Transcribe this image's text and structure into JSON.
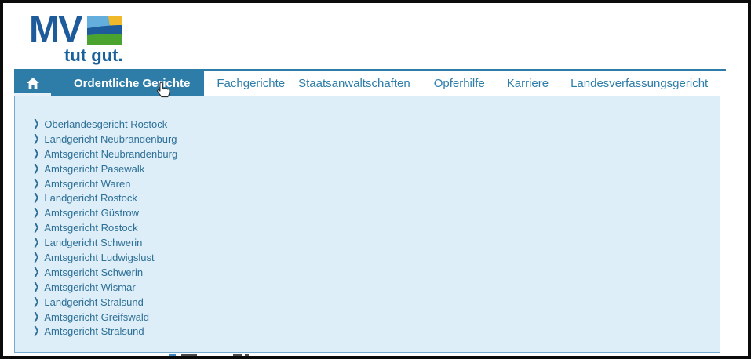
{
  "logo": {
    "text": "MV",
    "tagline": "tut gut."
  },
  "nav": {
    "active_index": 0,
    "items": [
      "Ordentliche Gerichte",
      "Fachgerichte",
      "Staatsanwaltschaften",
      "Opferhilfe",
      "Karriere",
      "Landesverfassungsgericht"
    ]
  },
  "dropdown": {
    "chevron": "❯",
    "items": [
      "Oberlandesgericht Rostock",
      "Landgericht Neubrandenburg",
      "Amtsgericht Neubrandenburg",
      "Amtsgericht Pasewalk",
      "Amtsgericht Waren",
      "Landgericht Rostock",
      "Amtsgericht Güstrow",
      "Amtsgericht Rostock",
      "Landgericht Schwerin",
      "Amtsgericht Ludwigslust",
      "Amtsgericht Schwerin",
      "Amtsgericht Wismar",
      "Landgericht Stralsund",
      "Amtsgericht Greifswald",
      "Amtsgericht Stralsund"
    ]
  },
  "colors": {
    "brand_blue": "#1d5b9b",
    "tagline_blue": "#18619d",
    "nav_blue": "#2d7da8",
    "panel_bg": "#ddeef8",
    "panel_border": "#74abcf",
    "list_text": "#2d6f96",
    "flag_sky": "#63aedd",
    "flag_yellow": "#f0b929",
    "flag_navy": "#1d5b9b",
    "flag_green": "#4aa32e"
  }
}
